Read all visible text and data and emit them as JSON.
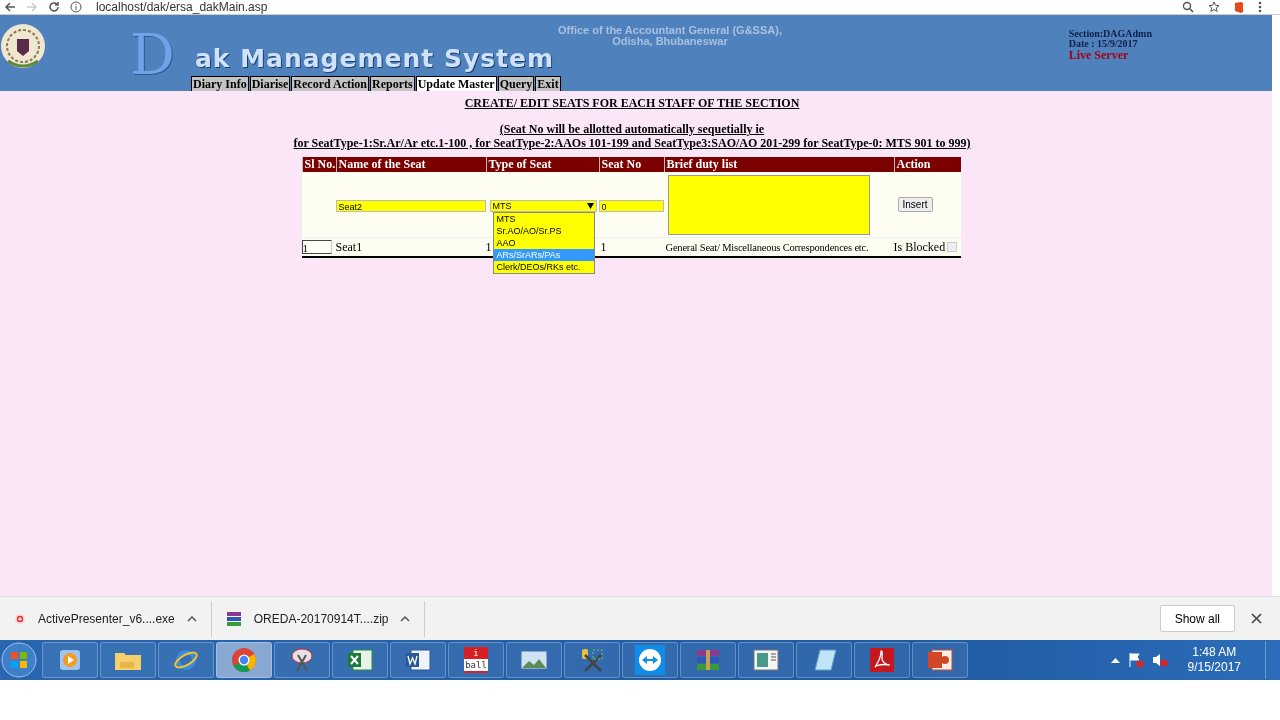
{
  "browser": {
    "url": "localhost/dak/ersa_dakMain.asp"
  },
  "banner": {
    "logo_initial": "D",
    "logo_rest": "ak Management System",
    "office_lines": [
      "Office of the Accountant General (G&SSA),",
      "Odisha, Bhubaneswar"
    ],
    "section": "Section:DAGAdmn",
    "date": "Date : 15/9/2017",
    "server": "Live Server"
  },
  "menu": [
    {
      "label": "Diary Info",
      "selected": false
    },
    {
      "label": "Diarise",
      "selected": false
    },
    {
      "label": "Record Action",
      "selected": false
    },
    {
      "label": "Reports",
      "selected": false
    },
    {
      "label": "Update Master",
      "selected": true
    },
    {
      "label": "Query",
      "selected": false
    },
    {
      "label": "Exit",
      "selected": false
    }
  ],
  "page_title": "CREATE/ EDIT SEATS FOR EACH STAFF OF THE SECTION",
  "note_lines": [
    "(Seat No will be allotted automatically sequetially ie",
    "for SeatType-1:Sr.Ar/Ar etc.1-100 , for SeatType-2:AAOs 101-199 and SeatType3:SAO/AO 201-299 for SeatType-0: MTS 901 to 999)"
  ],
  "table": {
    "columns": [
      "Sl No.",
      "Name of the Seat",
      "Type of Seat",
      "Seat No",
      "Brief duty list",
      "Action"
    ],
    "entry_row": {
      "name": "Seat2",
      "type": "MTS",
      "type_open": true,
      "seat_no": "0",
      "action": "Insert"
    },
    "type_options": [
      {
        "label": "MTS",
        "selected": false
      },
      {
        "label": "Sr.AO/AO/Sr.PS",
        "selected": false
      },
      {
        "label": "AAO",
        "selected": false
      },
      {
        "label": "ARs/SrARs/PAs",
        "selected": true
      },
      {
        "label": "Clerk/DEOs/RKs etc.",
        "selected": false
      }
    ],
    "rows": [
      {
        "sl_no": "1",
        "name": "Seat1",
        "type": "1",
        "seat_no": "1",
        "duty": "General Seat/ Miscellaneous Correspondences etc.",
        "status": "Is Blocked",
        "blocked": false
      }
    ]
  },
  "downloads": [
    {
      "name": "ActivePresenter_v6....exe",
      "kind": "installer"
    },
    {
      "name": "OREDA-20170914T....zip",
      "kind": "archive"
    }
  ],
  "download_bar": {
    "show_all": "Show all"
  },
  "taskbar": {
    "apps": [
      {
        "kind": "player"
      },
      {
        "kind": "folder"
      },
      {
        "kind": "ring"
      },
      {
        "kind": "tricolor",
        "active": true
      },
      {
        "kind": "scissors"
      },
      {
        "kind": "sheet"
      },
      {
        "kind": "document"
      },
      {
        "kind": "badge",
        "lines": [
          "i",
          "ball"
        ]
      },
      {
        "kind": "photo"
      },
      {
        "kind": "tools"
      },
      {
        "kind": "arrows"
      },
      {
        "kind": "books"
      },
      {
        "kind": "panel"
      },
      {
        "kind": "notepad"
      },
      {
        "kind": "pdf"
      },
      {
        "kind": "slides"
      }
    ],
    "time": "1:48 AM",
    "date": "9/15/2017"
  }
}
